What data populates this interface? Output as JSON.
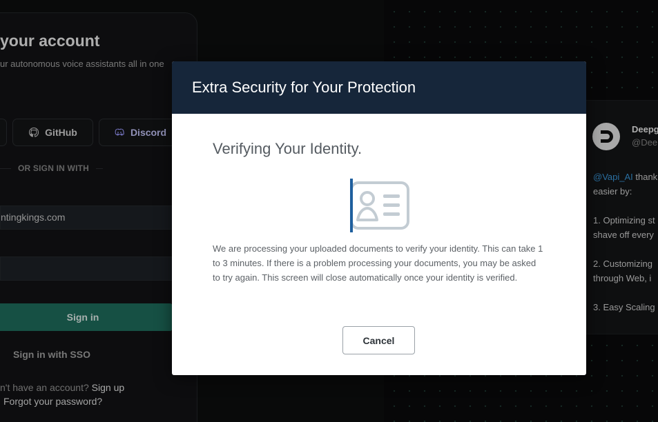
{
  "login": {
    "title": "your account",
    "subtitle": "ur autonomous voice assistants all in one",
    "oauth": {
      "github_label": "GitHub",
      "discord_label": "Discord"
    },
    "divider_label": "OR SIGN IN WITH",
    "email_value": "ntingkings.com",
    "password_value": "",
    "signin_label": "Sign in",
    "sso_label": "Sign in with SSO",
    "no_account_text": "n't have an account?",
    "signup_label": "Sign up",
    "forgot_label": "Forgot your password?"
  },
  "tweet": {
    "name": "Deepg",
    "handle": "@Dee",
    "mention": "@Vapi_AI",
    "line1_rest": " thank",
    "line2": "easier by:",
    "line3": "1. Optimizing st",
    "line4": "shave off every",
    "line5": "2. Customizing",
    "line6": "through Web, i",
    "line7": "3. Easy Scaling"
  },
  "modal": {
    "title": "Extra Security for Your Protection",
    "heading": "Verifying Your Identity.",
    "illustration_icon": "id-card-icon",
    "message": "We are processing your uploaded documents to verify your identity. This can take 1 to 3 minutes. If there is a problem processing your documents, you may be asked to try again. This screen will close automatically once your identity is verified.",
    "cancel_label": "Cancel"
  },
  "colors": {
    "modal_header_bg": "#16263a",
    "signin_bg": "#1f6f5f",
    "mention": "#3b9adf",
    "id_card_accent": "#1f5f9e"
  }
}
